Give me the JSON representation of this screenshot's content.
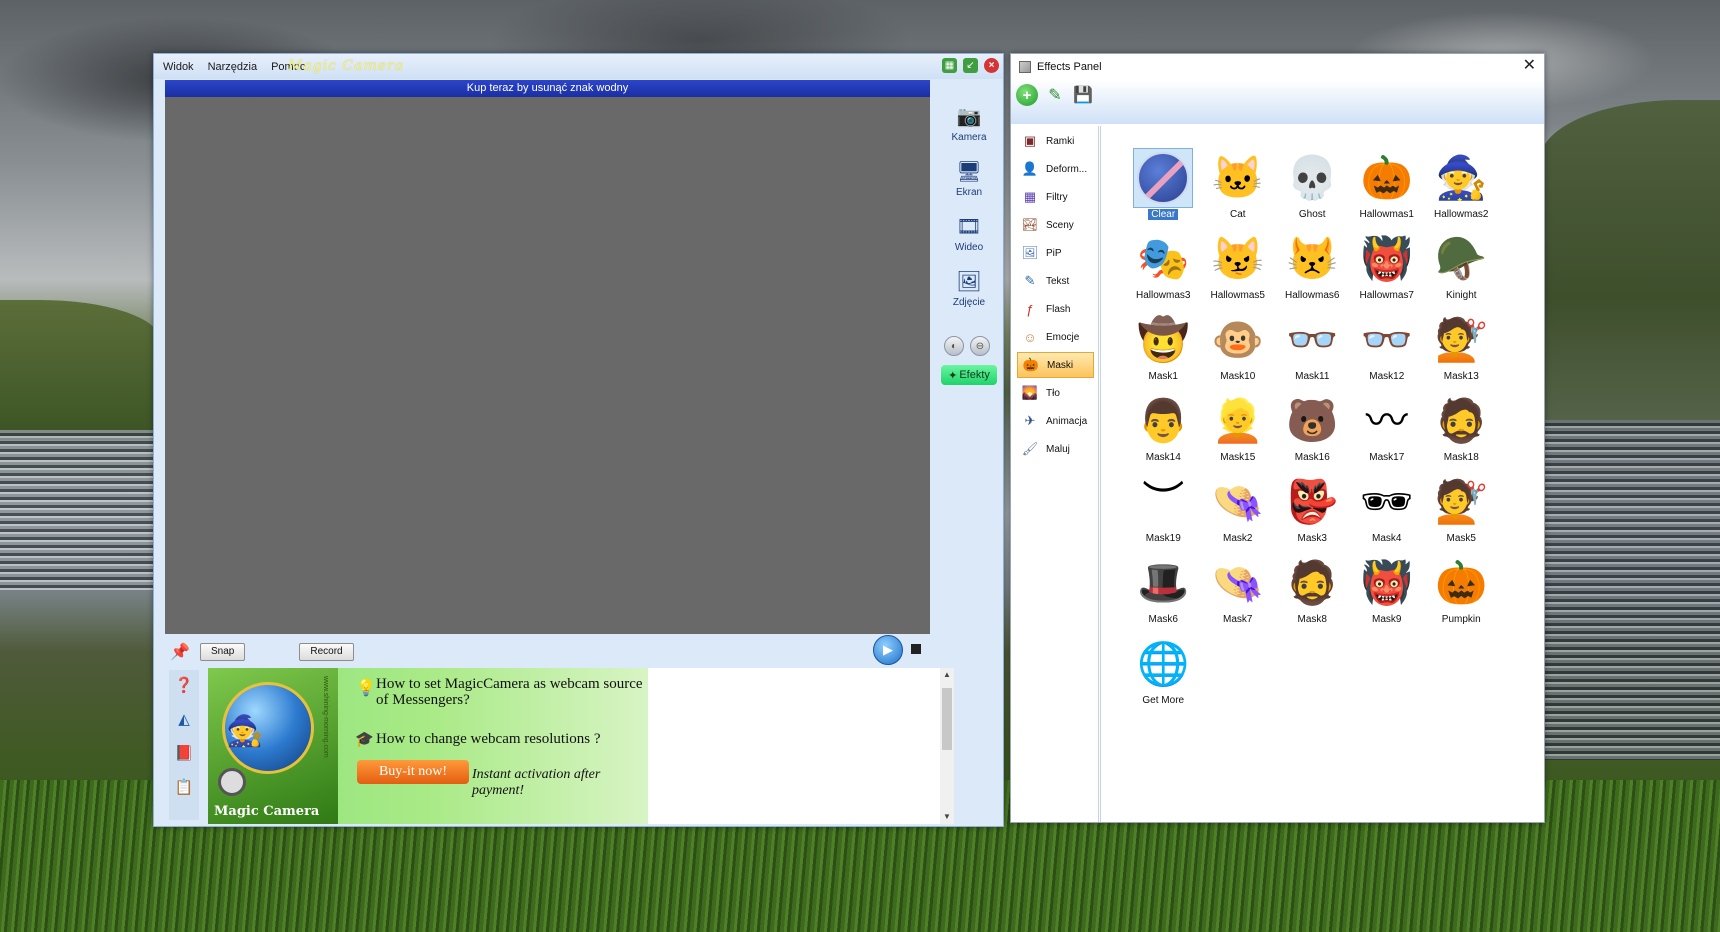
{
  "magic_camera": {
    "menu": [
      "Widok",
      "Narzędzia",
      "Pomoc"
    ],
    "title_logo": "Magic Camera",
    "watermark_banner": "Kup teraz by usunąć znak wodny",
    "toolbar": {
      "kamera": "Kamera",
      "ekran": "Ekran",
      "wideo": "Wideo",
      "zdjecie": "Zdjęcie",
      "efekty": "Efekty"
    },
    "buttons": {
      "snap": "Snap",
      "record": "Record"
    },
    "ad": {
      "line1": "How to set MagicCamera as webcam source of Messengers?",
      "line2": "How to change webcam resolutions ?",
      "buy": "Buy-it now!",
      "instant": "Instant activation after payment!",
      "box_label": "Magic Camera",
      "box_url": "www.shining-morning.com"
    }
  },
  "effects_panel": {
    "title": "Effects Panel",
    "categories": [
      {
        "label": "Ramki",
        "icon": "frame-icon"
      },
      {
        "label": "Deform...",
        "icon": "deform-icon"
      },
      {
        "label": "Filtry",
        "icon": "filter-icon"
      },
      {
        "label": "Sceny",
        "icon": "scene-icon"
      },
      {
        "label": "PiP",
        "icon": "pip-icon"
      },
      {
        "label": "Tekst",
        "icon": "text-icon"
      },
      {
        "label": "Flash",
        "icon": "flash-icon"
      },
      {
        "label": "Emocje",
        "icon": "emotion-icon"
      },
      {
        "label": "Maski",
        "icon": "mask-icon",
        "active": true
      },
      {
        "label": "Tło",
        "icon": "background-icon"
      },
      {
        "label": "Animacja",
        "icon": "animation-icon"
      },
      {
        "label": "Maluj",
        "icon": "paint-icon"
      }
    ],
    "effects": [
      {
        "label": "Clear",
        "selected": true
      },
      {
        "label": "Cat"
      },
      {
        "label": "Ghost"
      },
      {
        "label": "Hallowmas1"
      },
      {
        "label": "Hallowmas2"
      },
      {
        "label": "Hallowmas3"
      },
      {
        "label": "Hallowmas5"
      },
      {
        "label": "Hallowmas6"
      },
      {
        "label": "Hallowmas7"
      },
      {
        "label": "Kinight"
      },
      {
        "label": "Mask1"
      },
      {
        "label": "Mask10"
      },
      {
        "label": "Mask11"
      },
      {
        "label": "Mask12"
      },
      {
        "label": "Mask13"
      },
      {
        "label": "Mask14"
      },
      {
        "label": "Mask15"
      },
      {
        "label": "Mask16"
      },
      {
        "label": "Mask17"
      },
      {
        "label": "Mask18"
      },
      {
        "label": "Mask19"
      },
      {
        "label": "Mask2"
      },
      {
        "label": "Mask3"
      },
      {
        "label": "Mask4"
      },
      {
        "label": "Mask5"
      },
      {
        "label": "Mask6"
      },
      {
        "label": "Mask7"
      },
      {
        "label": "Mask8"
      },
      {
        "label": "Mask9"
      },
      {
        "label": "Pumpkin"
      },
      {
        "label": "Get More"
      }
    ]
  }
}
